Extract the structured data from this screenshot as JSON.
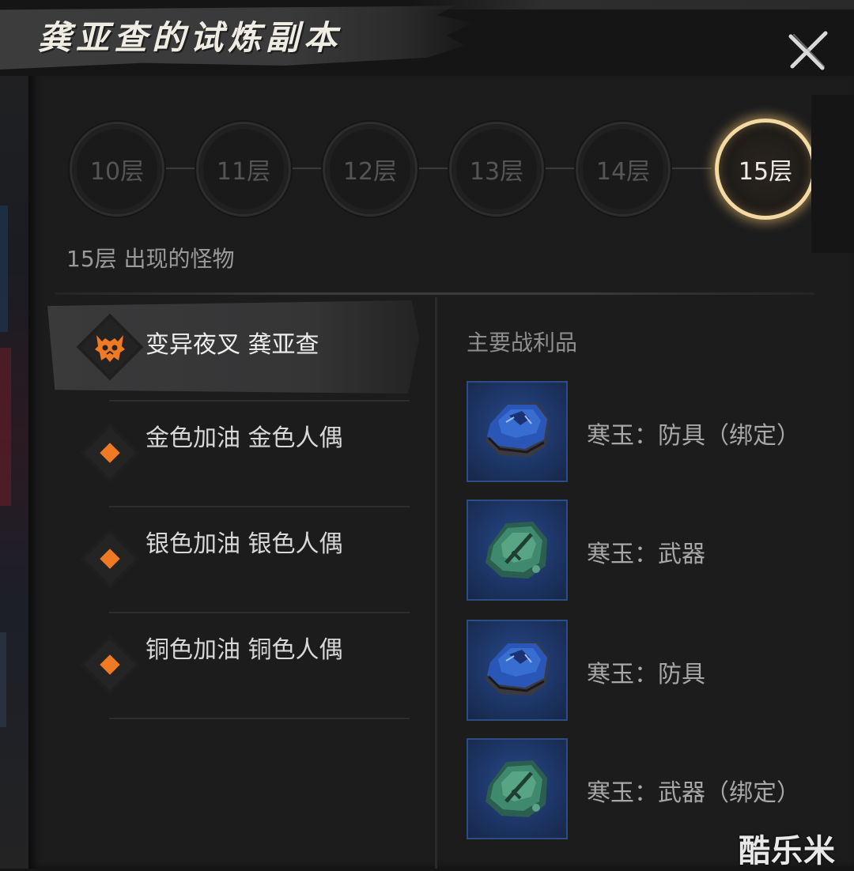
{
  "title": "龚亚查的试炼副本",
  "floors": [
    {
      "label": "10层",
      "active": false
    },
    {
      "label": "11层",
      "active": false
    },
    {
      "label": "12层",
      "active": false
    },
    {
      "label": "13层",
      "active": false
    },
    {
      "label": "14层",
      "active": false
    },
    {
      "label": "15层",
      "active": true
    }
  ],
  "section_label": "15层 出现的怪物",
  "monsters": [
    {
      "name": "变异夜叉 龚亚查",
      "selected": true,
      "icon": "demon-skull-icon"
    },
    {
      "name": "金色加油 金色人偶",
      "selected": false,
      "icon": "orange-diamond-icon"
    },
    {
      "name": "银色加油 银色人偶",
      "selected": false,
      "icon": "orange-diamond-icon"
    },
    {
      "name": "铜色加油 铜色人偶",
      "selected": false,
      "icon": "orange-diamond-icon"
    }
  ],
  "loot_title": "主要战利品",
  "loot": [
    {
      "label": "寒玉：防具（绑定）",
      "icon": "blue-jade-armor-icon"
    },
    {
      "label": "寒玉：武器",
      "icon": "green-jade-weapon-icon"
    },
    {
      "label": "寒玉：防具",
      "icon": "blue-jade-armor-icon"
    },
    {
      "label": "寒玉：武器（绑定）",
      "icon": "green-jade-weapon-icon"
    }
  ],
  "watermark": "酷乐米",
  "colors": {
    "accent_orange": "#f07a24",
    "active_ring": "#f3d9a2",
    "panel_bg": "#1c1c1d"
  }
}
